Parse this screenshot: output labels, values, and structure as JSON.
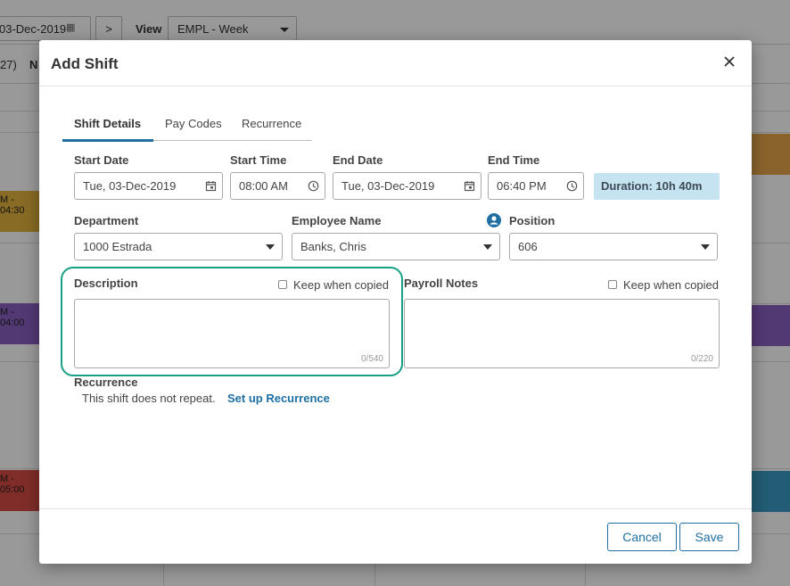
{
  "background": {
    "date": "03-Dec-2019",
    "next_glyph": ">",
    "view_label": "View",
    "view_value": "EMPL - Week",
    "count_text": "27)",
    "col_abbrev": "N",
    "shifts": [
      {
        "text": "M - 04:30",
        "color": "#e3b23c"
      },
      {
        "text": "M - 04:00",
        "color": "#8b5fc2"
      },
      {
        "text": "M - 05:00",
        "color": "#d64b45"
      },
      {
        "text": "",
        "color": "#e7a64a"
      },
      {
        "text": "",
        "color": "#8b5fc2"
      },
      {
        "text": "",
        "color": "#3a9ac4"
      }
    ]
  },
  "modal": {
    "title": "Add Shift",
    "tabs": [
      {
        "label": "Shift Details",
        "active": true
      },
      {
        "label": "Pay Codes",
        "active": false
      },
      {
        "label": "Recurrence",
        "active": false
      }
    ],
    "start_date": {
      "label": "Start Date",
      "value": "Tue, 03-Dec-2019"
    },
    "start_time": {
      "label": "Start Time",
      "value": "08:00 AM"
    },
    "end_date": {
      "label": "End Date",
      "value": "Tue, 03-Dec-2019"
    },
    "end_time": {
      "label": "End Time",
      "value": "06:40 PM"
    },
    "duration": "Duration: 10h 40m",
    "department": {
      "label": "Department",
      "value": "1000 Estrada"
    },
    "employee": {
      "label": "Employee Name",
      "value": "Banks, Chris"
    },
    "position": {
      "label": "Position",
      "value": "606"
    },
    "description": {
      "label": "Description",
      "keep_label": "Keep when copied",
      "counter": "0/540"
    },
    "payroll_notes": {
      "label": "Payroll Notes",
      "keep_label": "Keep when copied",
      "counter": "0/220"
    },
    "recurrence": {
      "label": "Recurrence",
      "text": "This shift does not repeat.",
      "link": "Set up Recurrence"
    },
    "buttons": {
      "cancel": "Cancel",
      "save": "Save"
    },
    "colors": {
      "accent": "#1f6fa3",
      "highlight": "#17a085",
      "duration_bg": "#c6e3f1"
    }
  }
}
